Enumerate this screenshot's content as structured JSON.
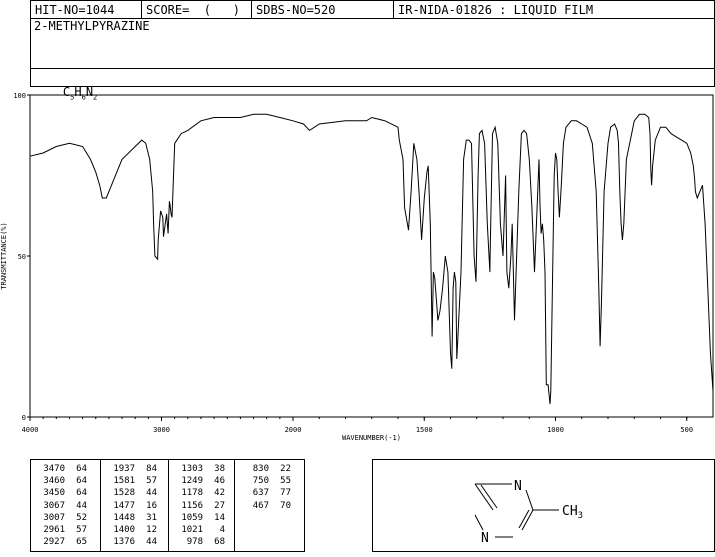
{
  "header": {
    "hit_no": "HIT-NO=1044",
    "score": "SCORE=  (   )",
    "sdbs_no": "SDBS-NO=520",
    "ir_info": "IR-NIDA-01826 : LIQUID FILM",
    "compound_name": "2-METHYLPYRAZINE",
    "formula": {
      "c": "C",
      "c_n": "5",
      "h": "H",
      "h_n": "6",
      "n": "N",
      "n_n": "2"
    }
  },
  "chart_data": {
    "type": "line",
    "title": "",
    "xlabel": "WAVENUMBER(-1)",
    "ylabel": "TRANSMITTANCE(%)",
    "xlim": [
      4000,
      400
    ],
    "ylim": [
      0,
      100
    ],
    "x_ticks": [
      "4000",
      "3000",
      "2000",
      "1500",
      "1000",
      "500"
    ],
    "y_ticks": [
      "100",
      "50",
      "0"
    ],
    "grid": false,
    "series": [
      {
        "name": "",
        "x": [
          4000,
          3900,
          3800,
          3700,
          3600,
          3540,
          3500,
          3470,
          3450,
          3420,
          3380,
          3300,
          3200,
          3150,
          3120,
          3090,
          3067,
          3060,
          3050,
          3030,
          3025,
          3007,
          2990,
          2985,
          2961,
          2950,
          2940,
          2935,
          2927,
          2920,
          2900,
          2850,
          2800,
          2700,
          2600,
          2500,
          2400,
          2300,
          2200,
          2100,
          2000,
          1960,
          1937,
          1900,
          1800,
          1750,
          1720,
          1700,
          1650,
          1600,
          1595,
          1581,
          1575,
          1560,
          1550,
          1540,
          1528,
          1520,
          1510,
          1500,
          1490,
          1485,
          1477,
          1470,
          1465,
          1460,
          1448,
          1440,
          1430,
          1420,
          1410,
          1400,
          1395,
          1390,
          1385,
          1380,
          1376,
          1370,
          1360,
          1350,
          1340,
          1330,
          1320,
          1310,
          1303,
          1295,
          1290,
          1280,
          1270,
          1260,
          1250,
          1249,
          1240,
          1230,
          1220,
          1210,
          1200,
          1190,
          1185,
          1178,
          1170,
          1165,
          1156,
          1150,
          1140,
          1130,
          1120,
          1110,
          1100,
          1090,
          1080,
          1070,
          1063,
          1059,
          1055,
          1050,
          1045,
          1040,
          1035,
          1028,
          1021,
          1018,
          1010,
          1005,
          1000,
          995,
          990,
          985,
          978,
          970,
          960,
          940,
          920,
          900,
          880,
          860,
          845,
          835,
          830,
          825,
          815,
          800,
          790,
          775,
          765,
          760,
          755,
          750,
          745,
          740,
          730,
          700,
          680,
          660,
          645,
          640,
          637,
          634,
          630,
          620,
          600,
          580,
          560,
          540,
          520,
          500,
          485,
          475,
          470,
          467,
          460,
          450,
          440,
          430,
          420,
          410,
          400
        ],
        "y": [
          81,
          82,
          84,
          85,
          84,
          80,
          76,
          72,
          68,
          68,
          72,
          80,
          84,
          86,
          85,
          80,
          70,
          60,
          50,
          49,
          55,
          64,
          62,
          56,
          63,
          57,
          67,
          66,
          63,
          62,
          85,
          88,
          89,
          92,
          93,
          93,
          93,
          94,
          94,
          93,
          92,
          91,
          89,
          91,
          92,
          92,
          92,
          93,
          92,
          90,
          86,
          80,
          65,
          58,
          70,
          85,
          80,
          70,
          55,
          68,
          76,
          78,
          60,
          25,
          45,
          43,
          30,
          33,
          40,
          50,
          45,
          20,
          15,
          40,
          45,
          42,
          18,
          28,
          45,
          80,
          86,
          86,
          85,
          50,
          42,
          75,
          88,
          89,
          85,
          60,
          45,
          50,
          88,
          90,
          85,
          60,
          50,
          75,
          45,
          40,
          50,
          60,
          30,
          45,
          70,
          88,
          89,
          88,
          80,
          65,
          45,
          65,
          80,
          66,
          57,
          60,
          55,
          45,
          10,
          10,
          4,
          8,
          50,
          75,
          82,
          80,
          70,
          62,
          72,
          85,
          90,
          92,
          92,
          91,
          90,
          85,
          70,
          40,
          22,
          35,
          70,
          85,
          90,
          91,
          89,
          85,
          70,
          60,
          55,
          60,
          80,
          92,
          94,
          94,
          93,
          88,
          77,
          72,
          78,
          86,
          90,
          90,
          88,
          87,
          86,
          85,
          82,
          78,
          74,
          70,
          68,
          70,
          72,
          60,
          40,
          20,
          8
        ]
      }
    ]
  },
  "peaks": [
    {
      "wn": "3470",
      "t": "64"
    },
    {
      "wn": "3460",
      "t": "64"
    },
    {
      "wn": "3450",
      "t": "64"
    },
    {
      "wn": "3067",
      "t": "44"
    },
    {
      "wn": "3007",
      "t": "52"
    },
    {
      "wn": "2961",
      "t": "57"
    },
    {
      "wn": "2927",
      "t": "65"
    },
    {
      "wn": "1937",
      "t": "84"
    },
    {
      "wn": "1581",
      "t": "57"
    },
    {
      "wn": "1528",
      "t": "44"
    },
    {
      "wn": "1477",
      "t": "16"
    },
    {
      "wn": "1448",
      "t": "31"
    },
    {
      "wn": "1400",
      "t": "12"
    },
    {
      "wn": "1376",
      "t": "44"
    },
    {
      "wn": "1303",
      "t": "38"
    },
    {
      "wn": "1249",
      "t": "46"
    },
    {
      "wn": "1178",
      "t": "42"
    },
    {
      "wn": "1156",
      "t": "27"
    },
    {
      "wn": "1059",
      "t": "14"
    },
    {
      "wn": "1021",
      "t": "4"
    },
    {
      "wn": "978",
      "t": "68"
    },
    {
      "wn": "830",
      "t": "22"
    },
    {
      "wn": "750",
      "t": "55"
    },
    {
      "wn": "637",
      "t": "77"
    },
    {
      "wn": "467",
      "t": "70"
    }
  ],
  "structure": {
    "atom_n1": "N",
    "atom_n2": "N",
    "methyl": "CH",
    "methyl_sub": "3"
  }
}
